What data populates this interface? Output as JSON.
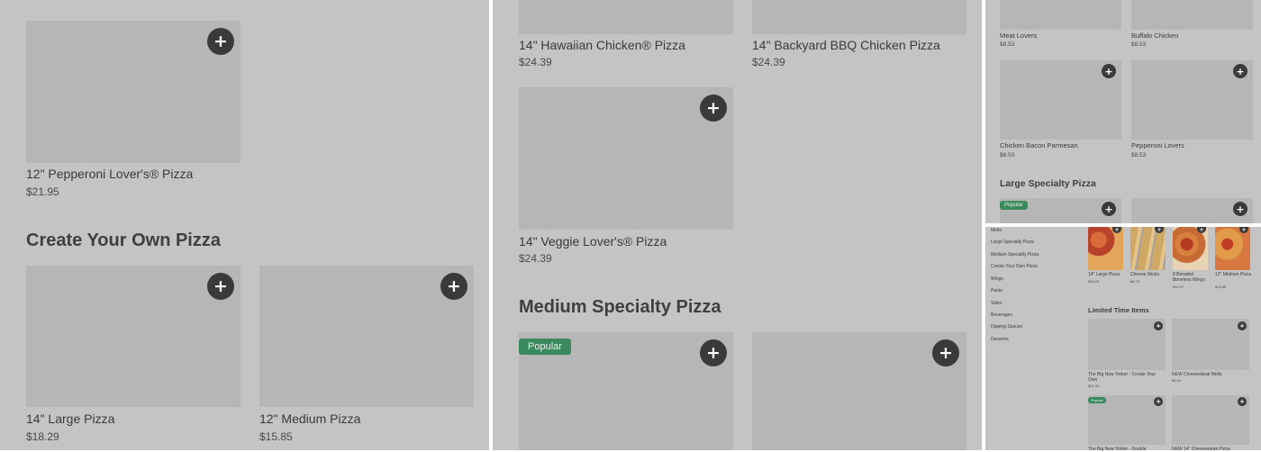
{
  "panel1": {
    "items": [
      {
        "name": "12\" Pepperoni Lover's® Pizza",
        "price": "$21.95",
        "add_icon": "plus-icon"
      },
      {
        "name": "14\" Large Pizza",
        "price": "$18.29",
        "add_icon": "plus-icon"
      },
      {
        "name": "12\" Medium Pizza",
        "price": "$15.85",
        "add_icon": "plus-icon"
      }
    ],
    "section_title": "Create Your Own Pizza"
  },
  "panel2": {
    "items": [
      {
        "name": "14\" Hawaiian Chicken® Pizza",
        "price": "$24.39"
      },
      {
        "name": "14\" Backyard BBQ Chicken Pizza",
        "price": "$24.39"
      },
      {
        "name": "14\" Veggie Lover's® Pizza",
        "price": "$24.39"
      }
    ],
    "section_title": "Medium Specialty Pizza",
    "badge": "Popular"
  },
  "panel3": {
    "items": [
      {
        "name": "Meat Lovers",
        "price": "$8.53"
      },
      {
        "name": "Buffalo Chicken",
        "price": "$8.53"
      },
      {
        "name": "Chicken Bacon Parmesan",
        "price": "$8.53"
      },
      {
        "name": "Pepperoni Lovers",
        "price": "$8.53"
      }
    ],
    "section_title": "Large Specialty Pizza",
    "badge": "Popular"
  },
  "panel4": {
    "nav": [
      "Melts",
      "Large Specialty Pizza",
      "Medium Specialty Pizza",
      "Create Your Own Pizza",
      "Wings",
      "Pasta",
      "Sides",
      "Beverages",
      "Dipping Sauces",
      "Desserts"
    ],
    "featured": [
      {
        "name": "14\" Large Pizza",
        "price": "$18.29"
      },
      {
        "name": "Cheese Sticks",
        "price": "$8.75"
      },
      {
        "name": "8 Breaded Boneless Wings",
        "price": "$10.97"
      },
      {
        "name": "12\" Medium Pizza",
        "price": "$15.85"
      }
    ],
    "section_title": "Limited Time Items",
    "limited": [
      {
        "name": "The Big New Yorker - Create Your Own",
        "price": "$21.99"
      },
      {
        "name": "NEW Cheesesteak Melts",
        "price": "$8.53"
      },
      {
        "name": "The Big New Yorker - Double",
        "price": ""
      },
      {
        "name": "NEW 14\" Cheesesteak Pizza",
        "price": ""
      }
    ],
    "badge": "Popular"
  },
  "colors": {
    "overlay": "#c4c4c4",
    "placeholder": "#b6b6b6",
    "button": "#3a3a3a",
    "badge": "#3a8a5e"
  }
}
